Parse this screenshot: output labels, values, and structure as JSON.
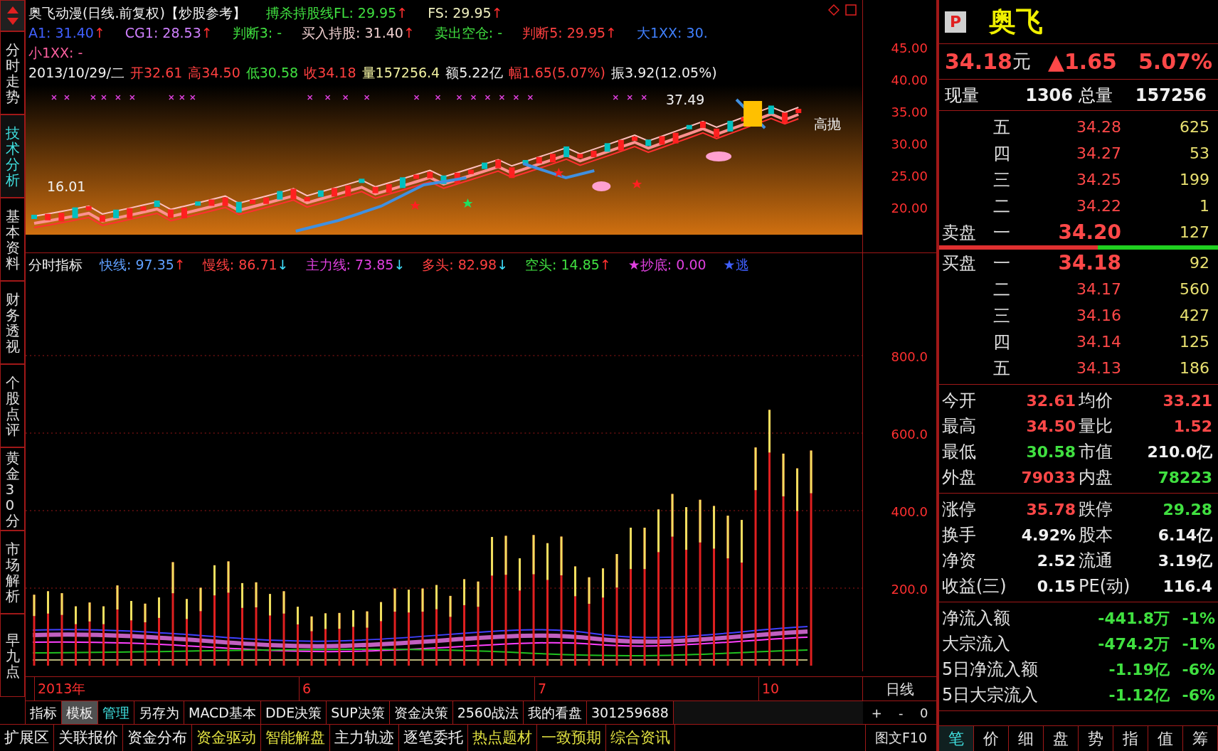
{
  "side_tabs": [
    {
      "label": "分时走势",
      "selected": false
    },
    {
      "label": "技术分析",
      "selected": true
    },
    {
      "label": "基本资料",
      "selected": false
    },
    {
      "label": "财务透视",
      "selected": false
    },
    {
      "label": "个股点评",
      "selected": false
    },
    {
      "label": "黄金30分",
      "selected": false
    },
    {
      "label": "市场解析",
      "selected": false
    },
    {
      "label": "早九点",
      "selected": false
    }
  ],
  "chart_header": {
    "title": "奥飞动漫(日线.前复权)【炒股参考】",
    "title_signals": [
      {
        "text": "搏杀持股线FL: 29.95",
        "color": "#40e040",
        "arrow": {
          "text": "↑",
          "color": "#ff3030"
        }
      },
      {
        "text": "FS: 29.95",
        "color": "#f0f0c0",
        "arrow": {
          "text": "↑",
          "color": "#ff3030"
        }
      }
    ],
    "signals": [
      {
        "text": "A1: 31.40",
        "color": "#4060ff",
        "arrow": {
          "text": "↑",
          "color": "#ff3030"
        }
      },
      {
        "text": "CG1: 28.53",
        "color": "#d080ff",
        "arrow": {
          "text": "↑",
          "color": "#ff3030"
        }
      },
      {
        "text": "判断3: -",
        "color": "#40e040"
      },
      {
        "text": "买入持股: 31.40",
        "color": "#f0d0d0",
        "arrow": {
          "text": "↑",
          "color": "#ff3030"
        }
      },
      {
        "text": "卖出空仓: -",
        "color": "#40e040"
      },
      {
        "text": "判断5: 29.95",
        "color": "#ff4040",
        "arrow": {
          "text": "↑",
          "color": "#ff3030"
        }
      },
      {
        "text": "大1XX: 30.",
        "color": "#4080ff"
      }
    ],
    "small_signal": {
      "text": "小1XX: -",
      "color": "#ff60a0"
    },
    "bar_info": [
      {
        "text": "2013/10/29/二",
        "color": "#f0f0f0"
      },
      {
        "text": "开32.61",
        "color": "#ff4040"
      },
      {
        "text": "高34.50",
        "color": "#ff4040"
      },
      {
        "text": "低30.58",
        "color": "#40e040"
      },
      {
        "text": "收34.18",
        "color": "#ff4040"
      },
      {
        "text": "量157256.4",
        "color": "#f0f0a0"
      },
      {
        "text": "额5.22亿",
        "color": "#f0f0f0"
      },
      {
        "text": "幅1.65(5.07%)",
        "color": "#ff4040"
      },
      {
        "text": "振3.92(12.05%)",
        "color": "#f0f0f0"
      }
    ]
  },
  "price_chart": {
    "labels": [
      "37.49",
      "16.01",
      "高抛"
    ],
    "axis": [
      "45.00",
      "40.00",
      "35.00",
      "30.00",
      "25.00",
      "20.00"
    ]
  },
  "indicator": {
    "title": "分时指标",
    "items": [
      {
        "text": "快线: 97.35",
        "color": "#60a0ff",
        "arrow": {
          "text": "↑",
          "color": "#ff3030"
        }
      },
      {
        "text": "慢线: 86.71",
        "color": "#ff4040",
        "arrow": {
          "text": "↓",
          "color": "#40e0ff"
        }
      },
      {
        "text": "主力线: 73.85",
        "color": "#e040e0",
        "arrow": {
          "text": "↓",
          "color": "#40e0ff"
        }
      },
      {
        "text": "多头: 82.98",
        "color": "#ff4040",
        "arrow": {
          "text": "↓",
          "color": "#40e0ff"
        }
      },
      {
        "text": "空头: 14.85",
        "color": "#40e040",
        "arrow": {
          "text": "↑",
          "color": "#ff3030"
        }
      },
      {
        "text": "★抄底: 0.00",
        "color": "#e040e0"
      },
      {
        "text": "★逃",
        "color": "#4060ff"
      }
    ],
    "axis": [
      "800.0",
      "600.0",
      "400.0",
      "200.0"
    ]
  },
  "date_axis": {
    "labels": [
      "2013年",
      "6",
      "7",
      "10"
    ],
    "period": "日线"
  },
  "toolbar": {
    "buttons": [
      {
        "label": "指标",
        "selected": false,
        "color": "#f0f0f0"
      },
      {
        "label": "模板",
        "selected": true,
        "color": "#f0f0f0"
      },
      {
        "label": "管理",
        "selected": false,
        "color": "#40e0e0"
      },
      {
        "label": "另存为",
        "selected": false,
        "color": "#f0f0f0"
      },
      {
        "label": "MACD基本",
        "selected": false,
        "color": "#f0f0f0"
      },
      {
        "label": "DDE决策",
        "selected": false,
        "color": "#f0f0f0"
      },
      {
        "label": "SUP决策",
        "selected": false,
        "color": "#f0f0f0"
      },
      {
        "label": "资金决策",
        "selected": false,
        "color": "#f0f0f0"
      },
      {
        "label": "2560战法",
        "selected": false,
        "color": "#f0f0f0"
      },
      {
        "label": "我的看盘",
        "selected": false,
        "color": "#f0f0f0"
      },
      {
        "label": "301259688",
        "selected": false,
        "color": "#f0f0f0"
      }
    ],
    "zoom": [
      "+",
      "-",
      "0"
    ]
  },
  "bottom_tabs": {
    "buttons": [
      {
        "label": "扩展区",
        "color": "#f0f0f0"
      },
      {
        "label": "关联报价",
        "color": "#f0f0f0"
      },
      {
        "label": "资金分布",
        "color": "#f0f0f0"
      },
      {
        "label": "资金驱动",
        "color": "#e0e040"
      },
      {
        "label": "智能解盘",
        "color": "#e0e040"
      },
      {
        "label": "主力轨迹",
        "color": "#f0f0f0"
      },
      {
        "label": "逐笔委托",
        "color": "#f0f0f0"
      },
      {
        "label": "热点题材",
        "color": "#e0e040"
      },
      {
        "label": "一致预期",
        "color": "#e0e040"
      },
      {
        "label": "综合资讯",
        "color": "#e0e040"
      }
    ],
    "f10": "图文F10"
  },
  "quote": {
    "badge": "P",
    "name": "奥飞",
    "price": "34.18",
    "unit": "元",
    "change": "▲1.65",
    "percent": "5.07%",
    "volume": [
      {
        "label": "现量",
        "value": "1306"
      },
      {
        "label": "总量",
        "value": "157256"
      }
    ],
    "asks": [
      {
        "kind": "normal",
        "level": "五",
        "price": "34.28",
        "qty": "625"
      },
      {
        "kind": "normal",
        "level": "四",
        "price": "34.27",
        "qty": "53"
      },
      {
        "kind": "normal",
        "level": "三",
        "price": "34.25",
        "qty": "199"
      },
      {
        "kind": "normal",
        "level": "二",
        "price": "34.22",
        "qty": "1"
      },
      {
        "kind": "best",
        "label": "卖盘",
        "level": "一",
        "price": "34.20",
        "qty": "127"
      }
    ],
    "ratio_bar": {
      "level": 0.57
    },
    "bids": [
      {
        "kind": "best",
        "label": "买盘",
        "level": "一",
        "price": "34.18",
        "qty": "92"
      },
      {
        "kind": "normal",
        "level": "二",
        "price": "34.17",
        "qty": "560"
      },
      {
        "kind": "normal",
        "level": "三",
        "price": "34.16",
        "qty": "427"
      },
      {
        "kind": "normal",
        "level": "四",
        "price": "34.14",
        "qty": "125"
      },
      {
        "kind": "normal",
        "level": "五",
        "price": "34.13",
        "qty": "186"
      }
    ],
    "stats": [
      [
        [
          {
            "label": "今开",
            "value": "32.61",
            "color": "#ff4848"
          },
          {
            "label": "均价",
            "value": "33.21",
            "color": "#ff4848"
          }
        ],
        [
          {
            "label": "最高",
            "value": "34.50",
            "color": "#ff4848"
          },
          {
            "label": "量比",
            "value": "1.52",
            "color": "#ff4848"
          }
        ],
        [
          {
            "label": "最低",
            "value": "30.58",
            "color": "#40e040"
          },
          {
            "label": "市值",
            "value": "210.0亿",
            "color": "#f0f0f0"
          }
        ],
        [
          {
            "label": "外盘",
            "value": "79033",
            "color": "#ff4848"
          },
          {
            "label": "内盘",
            "value": "78223",
            "color": "#40e040"
          }
        ]
      ],
      [
        [
          {
            "label": "涨停",
            "value": "35.78",
            "color": "#ff4848"
          },
          {
            "label": "跌停",
            "value": "29.28",
            "color": "#40e040"
          }
        ],
        [
          {
            "label": "换手",
            "value": "4.92%",
            "color": "#f0f0f0"
          },
          {
            "label": "股本",
            "value": "6.14亿",
            "color": "#f0f0f0"
          }
        ],
        [
          {
            "label": "净资",
            "value": "2.52",
            "color": "#f0f0f0"
          },
          {
            "label": "流通",
            "value": "3.19亿",
            "color": "#f0f0f0"
          }
        ],
        [
          {
            "label": "收益(三)",
            "value": "0.15",
            "color": "#f0f0f0"
          },
          {
            "label": "PE(动)",
            "value": "116.4",
            "color": "#f0f0f0"
          }
        ]
      ]
    ],
    "flows": [
      {
        "label": "净流入额",
        "value": "-441.8万",
        "percent": "-1%"
      },
      {
        "label": "大宗流入",
        "value": "-474.2万",
        "percent": "-1%"
      },
      {
        "label": "5日净流入额",
        "value": "-1.19亿",
        "percent": "-6%"
      },
      {
        "label": "5日大宗流入",
        "value": "-1.12亿",
        "percent": "-6%"
      }
    ],
    "tabs": [
      {
        "label": "笔",
        "selected": true
      },
      {
        "label": "价",
        "selected": false
      },
      {
        "label": "细",
        "selected": false
      },
      {
        "label": "盘",
        "selected": false
      },
      {
        "label": "势",
        "selected": false
      },
      {
        "label": "指",
        "selected": false
      },
      {
        "label": "值",
        "selected": false
      },
      {
        "label": "筹",
        "selected": false
      }
    ]
  }
}
